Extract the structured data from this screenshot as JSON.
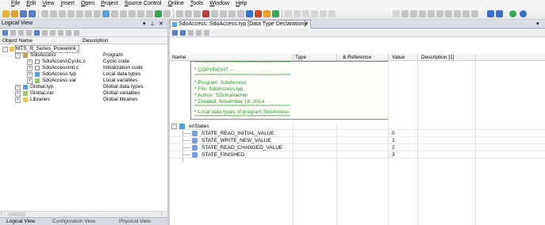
{
  "menu": [
    "File",
    "Edit",
    "View",
    "Insert",
    "Open",
    "Project",
    "Source Control",
    "Online",
    "Tools",
    "Window",
    "Help"
  ],
  "left_pane": {
    "title": "Logical View",
    "columns": [
      "Object Name",
      "Description"
    ],
    "items": [
      {
        "name": "MTS_R_Series_Powerlink_",
        "desc": "",
        "indent": 0,
        "icon": "folder-icon"
      },
      {
        "name": "SdoAccess",
        "desc": "Program",
        "indent": 1,
        "icon": "program-icon"
      },
      {
        "name": "SdoAccessCyclic.c",
        "desc": "Cyclic code",
        "indent": 2,
        "icon": "c-file-icon"
      },
      {
        "name": "SdoAccessInit.c",
        "desc": "Initialization code",
        "indent": 2,
        "icon": "c-file-icon"
      },
      {
        "name": "SdoAccess.typ",
        "desc": "Local data types",
        "indent": 2,
        "icon": "typ-file-icon"
      },
      {
        "name": "SdoAccess.var",
        "desc": "Local variables",
        "indent": 2,
        "icon": "var-file-icon"
      },
      {
        "name": "Global.typ",
        "desc": "Global data types",
        "indent": 1,
        "icon": "typ-file-icon"
      },
      {
        "name": "Global.var",
        "desc": "Global variables",
        "indent": 1,
        "icon": "var-file-icon"
      },
      {
        "name": "Libraries",
        "desc": "Global libraries",
        "indent": 1,
        "icon": "folder-icon"
      }
    ],
    "bottom_tabs": [
      "Logical View",
      "Configuration View",
      "Physical View"
    ]
  },
  "editor": {
    "tab_title": "SdoAccess::SdoAccess.typ [Data Type Declaration]*",
    "columns": [
      "Name",
      "Type",
      "& Reference",
      "Value",
      "Description [1]"
    ],
    "comment_lines": [
      "**************************************************************",
      "* COPYRIGHT --",
      "**************************************************************",
      "* Program: SdoAccess",
      "* File: SdoAccess.typ",
      "* Author: SSchumacher",
      "* Created: November 18, 2014",
      "**************************************************************",
      "* Local data types of program SdoAccess",
      "**************************************************************"
    ],
    "enum_name": "enStates",
    "members": [
      {
        "name": "STATE_READ_INITIAL_VALUE",
        "value": "0"
      },
      {
        "name": "STATE_WRITE_NEW_VALUE",
        "value": "1"
      },
      {
        "name": "STATE_READ_CHANGED_VALUE",
        "value": "2"
      },
      {
        "name": "STATE_FINISHED",
        "value": "3"
      }
    ]
  },
  "colors": {
    "comment_text": "#2a8a2a",
    "accent": "#3a6fc4"
  }
}
